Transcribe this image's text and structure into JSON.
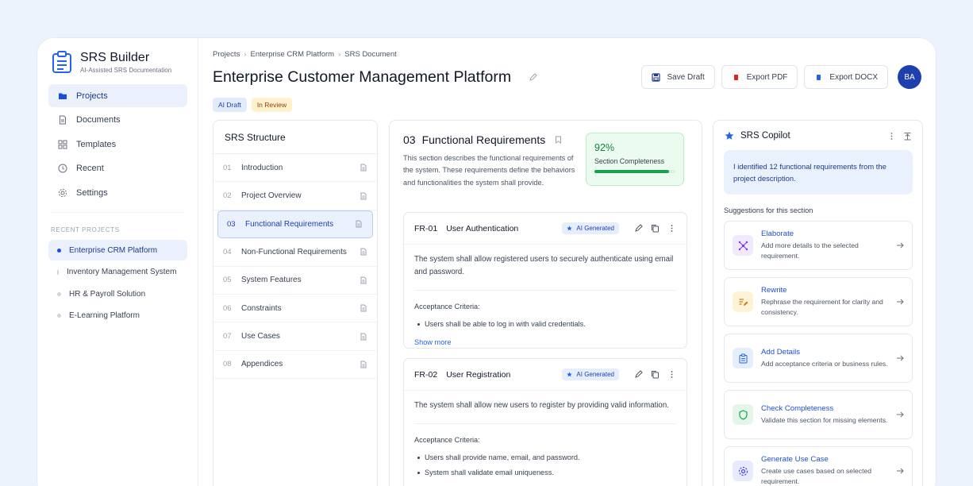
{
  "app": {
    "name": "SRS Builder",
    "subtitle": "AI-Assisted SRS Documentation"
  },
  "sidebar": {
    "nav": [
      {
        "label": "Projects",
        "icon": "folder-icon",
        "active": true
      },
      {
        "label": "Documents",
        "icon": "document-icon"
      },
      {
        "label": "Templates",
        "icon": "grid-icon"
      },
      {
        "label": "Recent",
        "icon": "clock-icon"
      },
      {
        "label": "Settings",
        "icon": "gear-icon"
      }
    ],
    "recent_heading": "RECENT PROJECTS",
    "recent_projects": [
      {
        "label": "Enterprise CRM Platform",
        "active": true
      },
      {
        "label": "Inventory Management System"
      },
      {
        "label": "HR & Payroll Solution"
      },
      {
        "label": "E-Learning Platform"
      }
    ]
  },
  "breadcrumb": [
    "Projects",
    "Enterprise CRM Platform",
    "SRS Document"
  ],
  "page": {
    "title": "Enterprise Customer Management Platform",
    "badges": [
      "AI Draft",
      "In Review"
    ]
  },
  "toolbar": {
    "save_draft": "Save Draft",
    "export_pdf": "Export PDF",
    "export_docx": "Export DOCX",
    "avatar_initials": "BA"
  },
  "structure": {
    "heading": "SRS Structure",
    "items": [
      {
        "num": "01",
        "label": "Introduction"
      },
      {
        "num": "02",
        "label": "Project Overview"
      },
      {
        "num": "03",
        "label": "Functional Requirements",
        "active": true
      },
      {
        "num": "04",
        "label": "Non-Functional Requirements"
      },
      {
        "num": "05",
        "label": "System Features"
      },
      {
        "num": "06",
        "label": "Constraints"
      },
      {
        "num": "07",
        "label": "Use Cases"
      },
      {
        "num": "08",
        "label": "Appendices"
      }
    ]
  },
  "section": {
    "number": "03",
    "title": "Functional Requirements",
    "description": "This section describes the functional requirements of the system. These requirements define the behaviors and functionalities the system shall provide.",
    "completeness": {
      "value": "92%",
      "label": "Section Completeness",
      "fraction": 0.92
    },
    "requirements": [
      {
        "id": "FR-01",
        "name": "User Authentication",
        "tag": "AI Generated",
        "text": "The system shall allow registered users to securely authenticate using email and password.",
        "acceptance_label": "Acceptance Criteria:",
        "criteria": [
          "Users shall be able to log in with valid credentials."
        ],
        "show_more": "Show more"
      },
      {
        "id": "FR-02",
        "name": "User Registration",
        "tag": "AI Generated",
        "text": "The system shall allow new users to register by providing valid information.",
        "acceptance_label": "Acceptance Criteria:",
        "criteria": [
          "Users shall provide name, email, and password.",
          "System shall validate email uniqueness."
        ]
      }
    ]
  },
  "copilot": {
    "title": "SRS Copilot",
    "message": "I identified 12 functional requirements from the project description.",
    "suggestions_heading": "Suggestions for this section",
    "suggestions": [
      {
        "title": "Elaborate",
        "desc": "Add more details to the selected requirement.",
        "icon": "nodes-icon",
        "color": "#7c3aed",
        "bg": "#f1e9fe"
      },
      {
        "title": "Rewrite",
        "desc": "Rephrase the requirement for clarity and consistency.",
        "icon": "pen-lines-icon",
        "color": "#d97706",
        "bg": "#fdf3d7"
      },
      {
        "title": "Add Details",
        "desc": "Add acceptance criteria or business rules.",
        "icon": "clipboard-icon",
        "color": "#2563eb",
        "bg": "#e4eefc"
      },
      {
        "title": "Check Completeness",
        "desc": "Validate this section for missing elements.",
        "icon": "shield-icon",
        "color": "#16a34a",
        "bg": "#e3f7e8"
      },
      {
        "title": "Generate Use Case",
        "desc": "Create use cases based on selected requirement.",
        "icon": "gear-icon",
        "color": "#4f46e5",
        "bg": "#e8ebfd"
      }
    ]
  }
}
